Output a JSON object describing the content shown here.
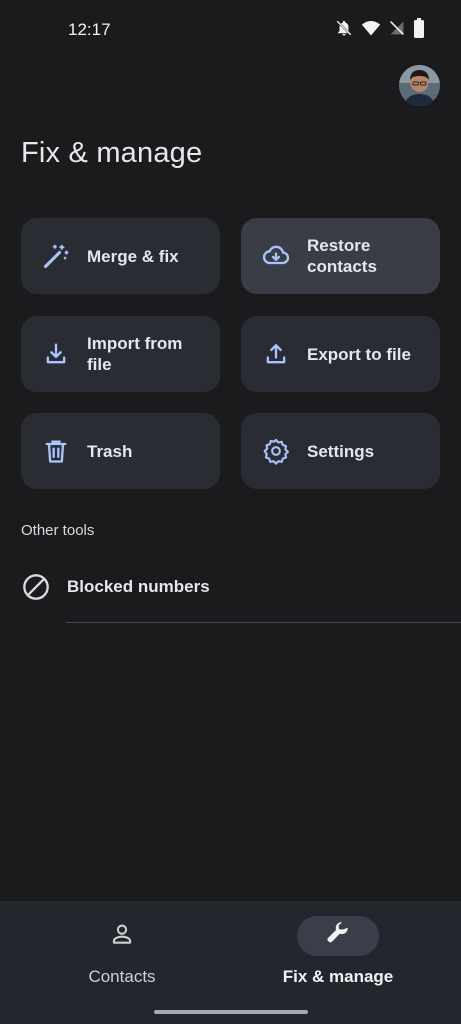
{
  "status_bar": {
    "time": "12:17",
    "icons": [
      "bell-off-icon",
      "wifi-icon",
      "no-signal-icon",
      "battery-icon"
    ]
  },
  "header": {
    "title": "Fix & manage",
    "avatar": "profile-avatar"
  },
  "tiles": [
    {
      "id": "merge",
      "label": "Merge & fix",
      "icon": "magic-wand-icon"
    },
    {
      "id": "restore",
      "label": "Restore contacts",
      "icon": "cloud-download-icon",
      "selected": true
    },
    {
      "id": "import",
      "label": "Import from file",
      "icon": "download-icon"
    },
    {
      "id": "export",
      "label": "Export to file",
      "icon": "upload-icon"
    },
    {
      "id": "trash",
      "label": "Trash",
      "icon": "trash-icon"
    },
    {
      "id": "settings",
      "label": "Settings",
      "icon": "gear-icon"
    }
  ],
  "other_tools": {
    "header": "Other tools",
    "items": [
      {
        "label": "Blocked numbers",
        "icon": "block-icon"
      }
    ]
  },
  "bottom_nav": {
    "items": [
      {
        "label": "Contacts",
        "icon": "person-icon",
        "active": false
      },
      {
        "label": "Fix & manage",
        "icon": "wrench-icon",
        "active": true
      }
    ]
  },
  "colors": {
    "background": "#1b1b1d",
    "tile": "#2a2c33",
    "tile_selected": "#3a3d46",
    "icon_accent": "#a9c3ff",
    "nav_bar": "#24262d"
  }
}
